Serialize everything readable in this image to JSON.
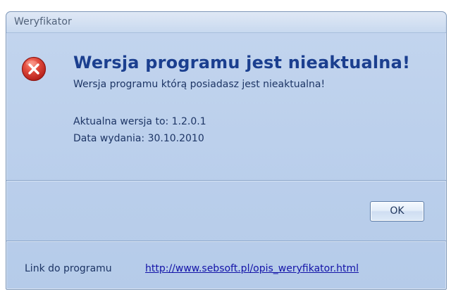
{
  "window": {
    "title": "Weryfikator"
  },
  "message": {
    "icon": "error-icon",
    "heading": "Wersja programu jest nieaktualna!",
    "description": "Wersja programu którą posiadasz jest nieaktualna!",
    "current_version": "Aktualna wersja to: 1.2.0.1",
    "release_date": "Data wydania: 30.10.2010"
  },
  "buttons": {
    "ok": "OK"
  },
  "footer": {
    "label": "Link do programu",
    "link": "http://www.sebsoft.pl/opis_weryfikator.html"
  },
  "colors": {
    "heading": "#1b3f8f",
    "error_icon": "#d33b30",
    "link": "#1313a8"
  }
}
